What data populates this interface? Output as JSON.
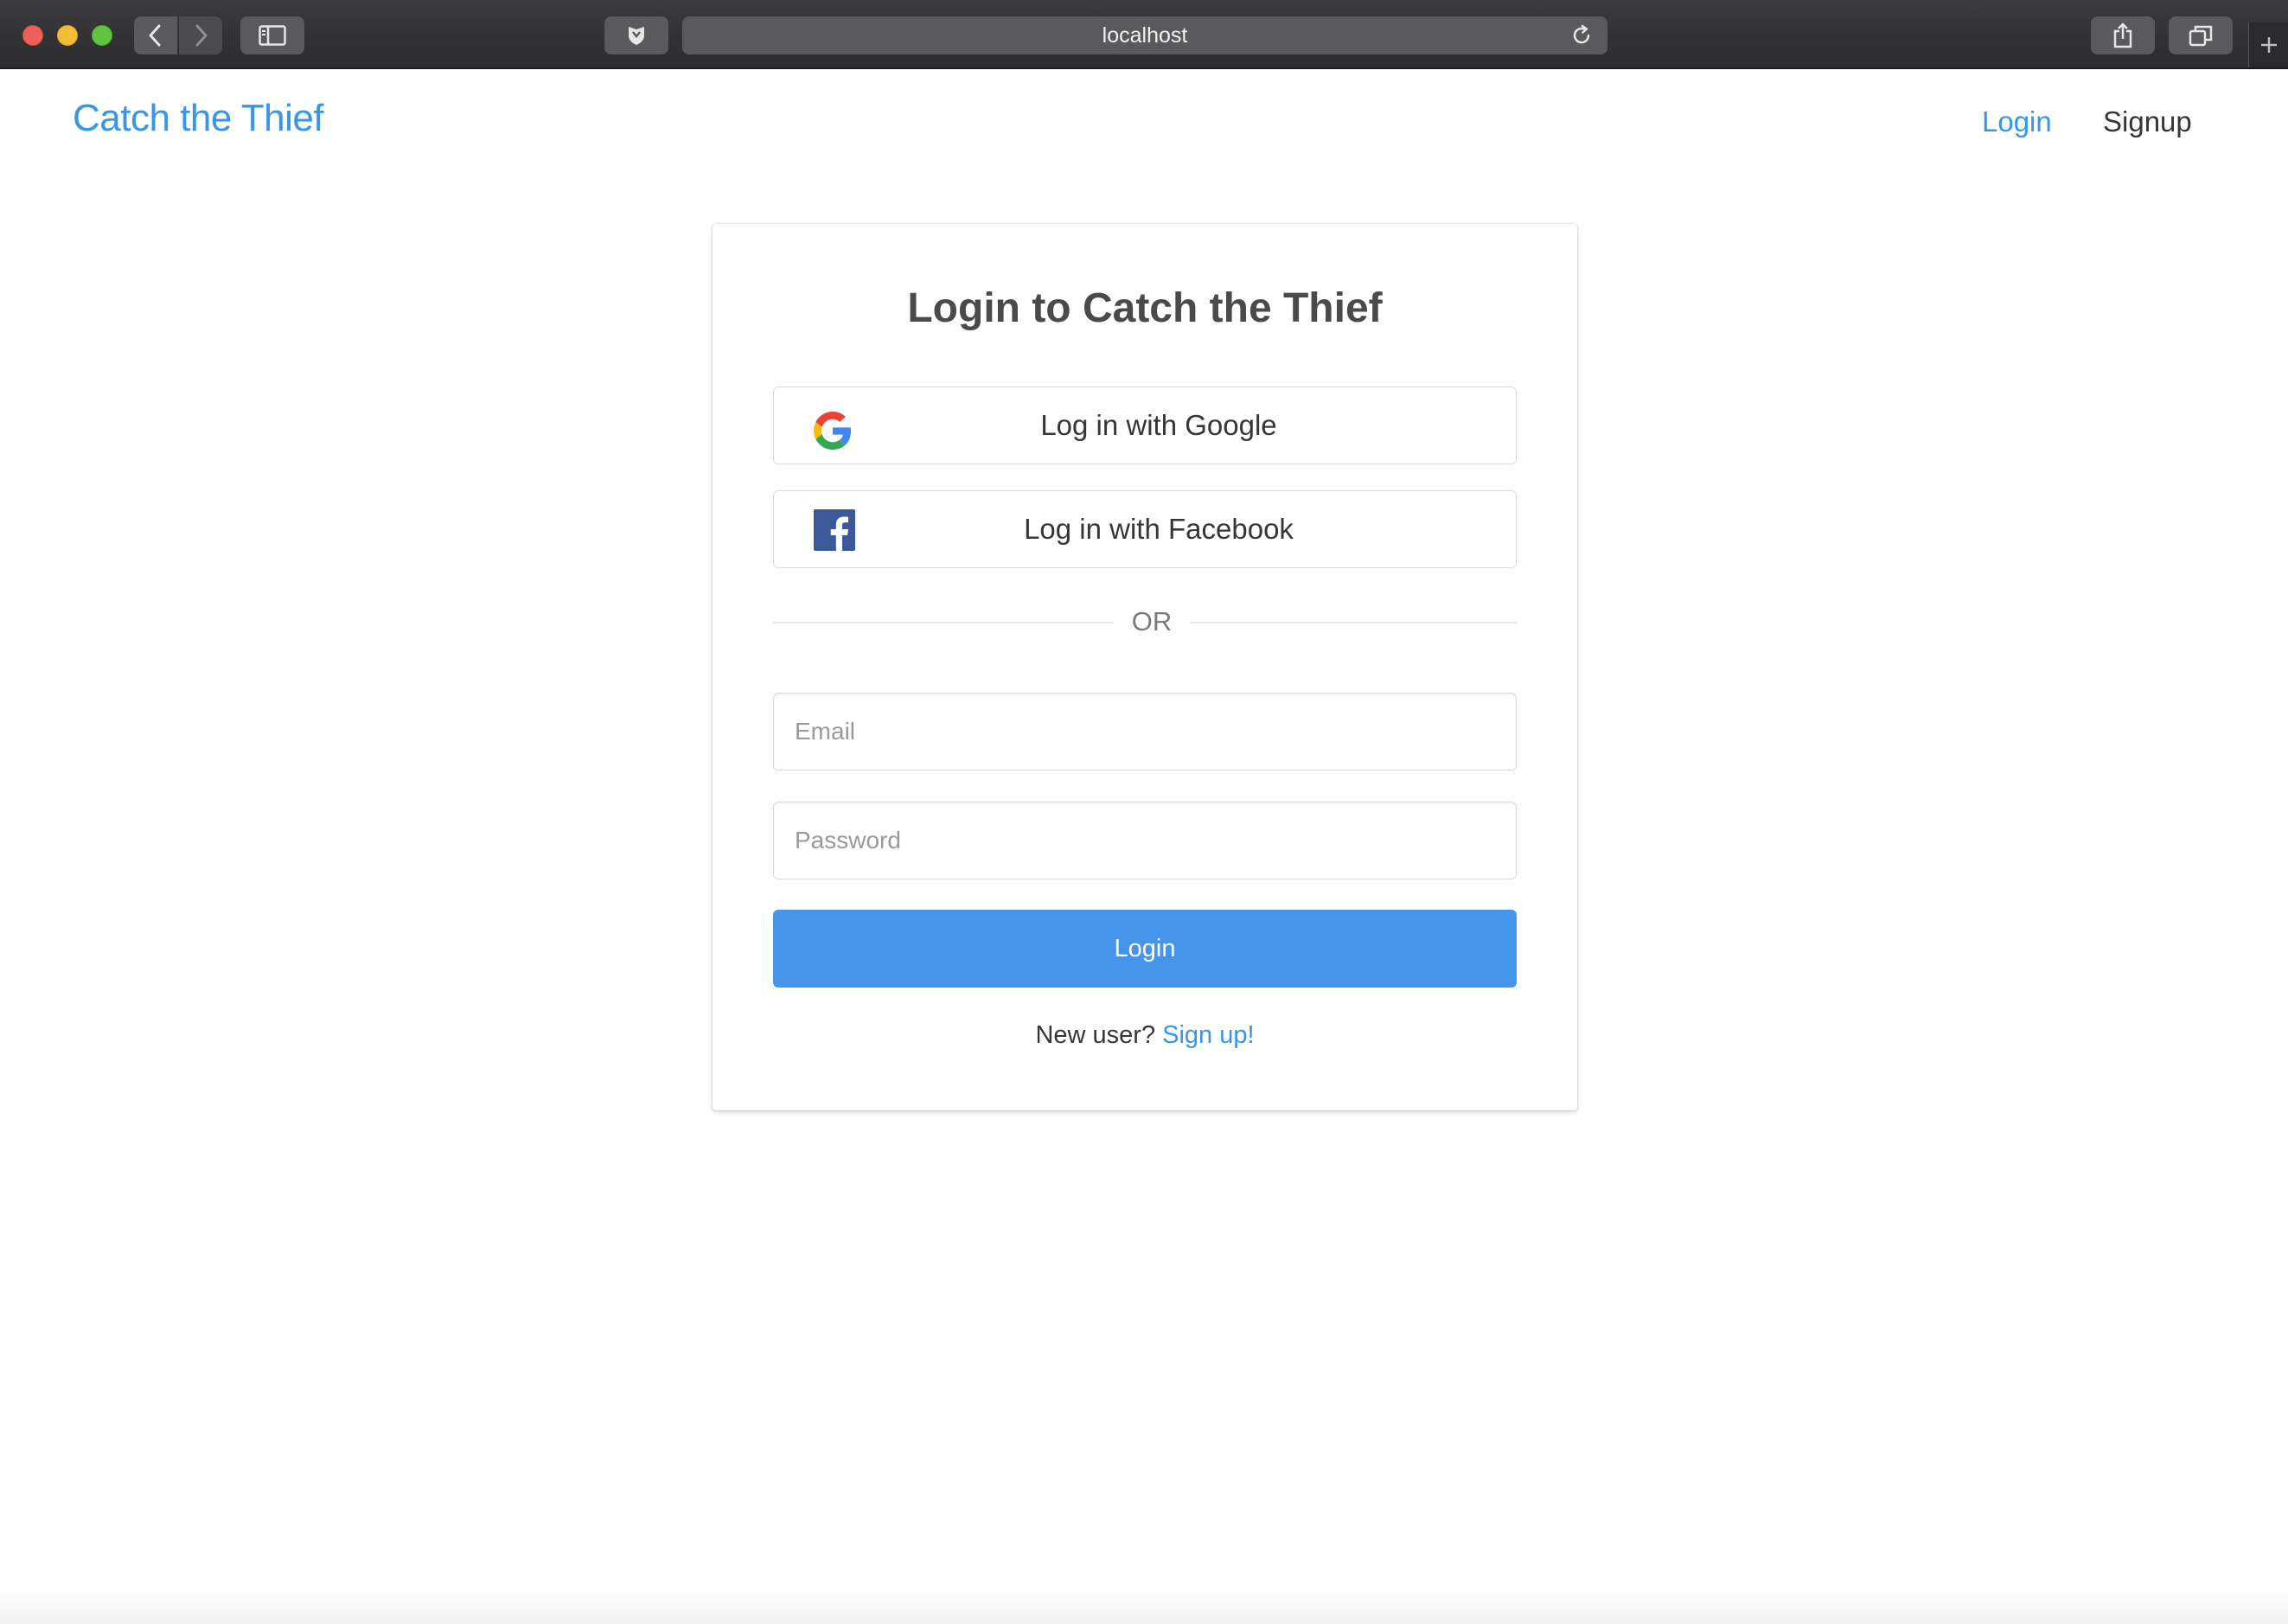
{
  "browser": {
    "url": "localhost"
  },
  "navbar": {
    "brand": "Catch the Thief",
    "login_link": "Login",
    "signup_link": "Signup"
  },
  "login_card": {
    "title": "Login to Catch the Thief",
    "google_button": "Log in with Google",
    "facebook_button": "Log in with Facebook",
    "divider": "OR",
    "email_placeholder": "Email",
    "email_value": "",
    "password_placeholder": "Password",
    "password_value": "",
    "submit_button": "Login",
    "new_user_prompt": "New user?",
    "signup_link": "Sign up!"
  },
  "icons": {
    "google": "google-logo-icon",
    "facebook": "facebook-logo-icon"
  },
  "colors": {
    "accent": "#3a95e8",
    "primary_button": "#4596ea",
    "facebook_blue": "#3b5998",
    "text_dark": "#363636"
  }
}
